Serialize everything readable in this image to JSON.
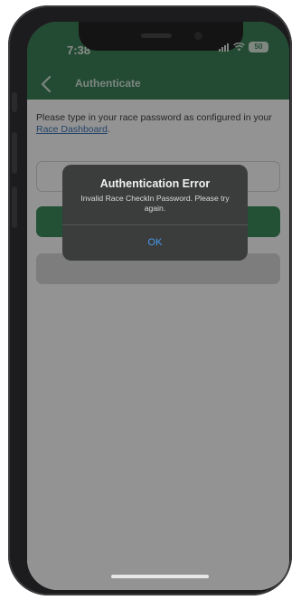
{
  "status_bar": {
    "time": "7:38",
    "battery": "50"
  },
  "nav": {
    "title": "Authenticate"
  },
  "content": {
    "instructions_prefix": "Please type in your race password as configured in your ",
    "dashboard_link": "Race Dashboard",
    "instructions_suffix": "."
  },
  "alert": {
    "title": "Authentication Error",
    "message": "Invalid Race CheckIn Password. Please try again.",
    "ok_label": "OK"
  },
  "colors": {
    "header_green": "#1e6e3e",
    "button_green": "#1e7a45",
    "alert_background": "#3a3d3c",
    "ok_blue": "#4a9bf0"
  }
}
